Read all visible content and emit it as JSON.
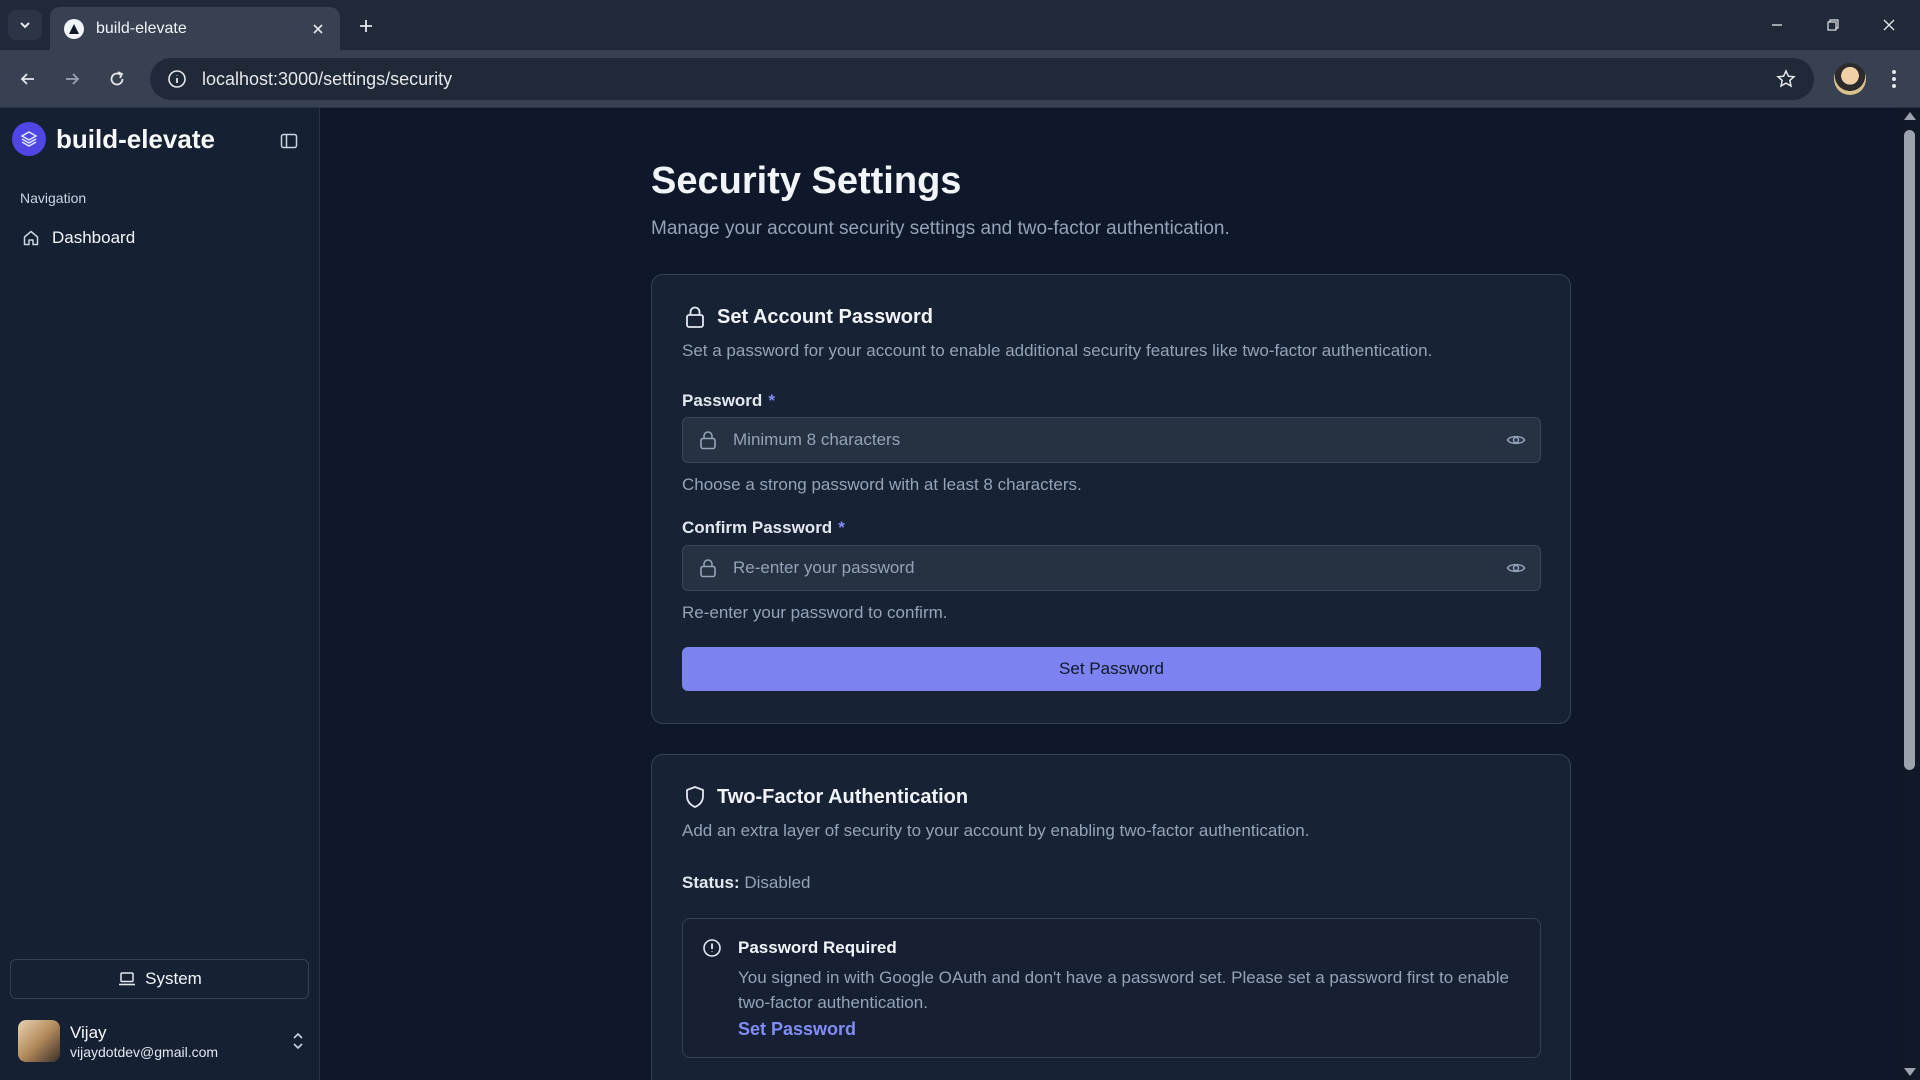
{
  "browser": {
    "tab_title": "build-elevate",
    "url": "localhost:3000/settings/security"
  },
  "sidebar": {
    "brand": "build-elevate",
    "nav_heading": "Navigation",
    "items": [
      {
        "label": "Dashboard",
        "icon": "home-icon"
      }
    ],
    "theme_button": "System",
    "user": {
      "name": "Vijay",
      "email": "vijaydotdev@gmail.com"
    }
  },
  "page": {
    "title": "Security Settings",
    "subtitle": "Manage your account security settings and two-factor authentication."
  },
  "password_card": {
    "title": "Set Account Password",
    "description": "Set a password for your account to enable additional security features like two-factor authentication.",
    "password": {
      "label": "Password",
      "required_mark": "*",
      "placeholder": "Minimum 8 characters",
      "value": "",
      "help": "Choose a strong password with at least 8 characters."
    },
    "confirm": {
      "label": "Confirm Password",
      "required_mark": "*",
      "placeholder": "Re-enter your password",
      "value": "",
      "help": "Re-enter your password to confirm."
    },
    "submit_label": "Set Password"
  },
  "twofa_card": {
    "title": "Two-Factor Authentication",
    "description": "Add an extra layer of security to your account by enabling two-factor authentication.",
    "status_label": "Status:",
    "status_value": "Disabled",
    "alert": {
      "title": "Password Required",
      "body": "You signed in with Google OAuth and don't have a password set. Please set a password first to enable two-factor authentication.",
      "link": "Set Password"
    }
  },
  "colors": {
    "background": "#0f172a",
    "sidebar": "#162033",
    "card": "#182235",
    "accent": "#7c83f0",
    "link": "#818cf8"
  }
}
